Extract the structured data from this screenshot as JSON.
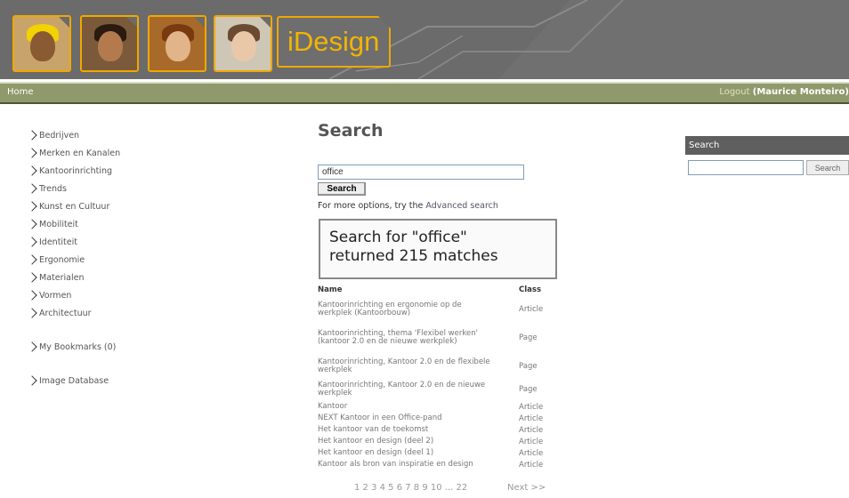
{
  "header": {
    "logo_text": "iDesign",
    "photos": [
      {
        "icon": "worker-hardhat-photo",
        "bg": "#c9a46a",
        "face": "#8a5a33",
        "hair": "#f2d200"
      },
      {
        "icon": "woman-smiling-photo",
        "bg": "#7a5a3a",
        "face": "#b37a4e",
        "hair": "#2a1a10"
      },
      {
        "icon": "woman-phone-photo",
        "bg": "#a86a2a",
        "face": "#e2b48a",
        "hair": "#7a3a10"
      },
      {
        "icon": "headset-operator-photo",
        "bg": "#cfc7b5",
        "face": "#e8c8a8",
        "hair": "#6a4a30"
      }
    ],
    "accent": "#f0a800"
  },
  "navbar": {
    "home_label": "Home",
    "logout_label": "Logout",
    "user_name": "(Maurice Monteiro)"
  },
  "leftnav": {
    "items": [
      "Bedrijven",
      "Merken en Kanalen",
      "Kantoorinrichting",
      "Trends",
      "Kunst en Cultuur",
      "Mobiliteit",
      "Identiteit",
      "Ergonomie",
      "Materialen",
      "Vormen",
      "Architectuur",
      "My Bookmarks (0)",
      "Image Database"
    ]
  },
  "main": {
    "title": "Search",
    "query_value": "office",
    "search_button": "Search",
    "more_options_prefix": "For more options, try the ",
    "more_options_link": "Advanced search",
    "results_summary_line1": "Search for \"office\"",
    "results_summary_line2": "returned 215 matches",
    "col_name": "Name",
    "col_class": "Class",
    "rows": [
      {
        "name": "Kantoorinrichting en ergonomie op de werkplek (Kantoorbouw)",
        "cls": "Article"
      },
      {
        "name": "Kantoorinrichting, thema 'Flexibel werken' (kantoor 2.0 en de nieuwe werkplek)",
        "cls": "Page"
      },
      {
        "name": "Kantoorinrichting, Kantoor 2.0 en de flexibele werkplek",
        "cls": "Page"
      },
      {
        "name": "Kantoorinrichting, Kantoor 2.0 en de nieuwe werkplek",
        "cls": "Page"
      },
      {
        "name": "Kantoor",
        "cls": "Article"
      },
      {
        "name": "NEXT Kantoor in een Office-pand",
        "cls": "Article"
      },
      {
        "name": "Het kantoor van de toekomst",
        "cls": "Article"
      },
      {
        "name": "Het kantoor en design (deel 2)",
        "cls": "Article"
      },
      {
        "name": "Het kantoor en design (deel 1)",
        "cls": "Article"
      },
      {
        "name": "Kantoor als bron van inspiratie en design",
        "cls": "Article"
      }
    ],
    "pager_pages": "1 2 3 4 5 6 7 8 9 10 ... 22",
    "pager_next": "Next >>"
  },
  "rightsearch": {
    "title": "Search",
    "button": "Search"
  }
}
